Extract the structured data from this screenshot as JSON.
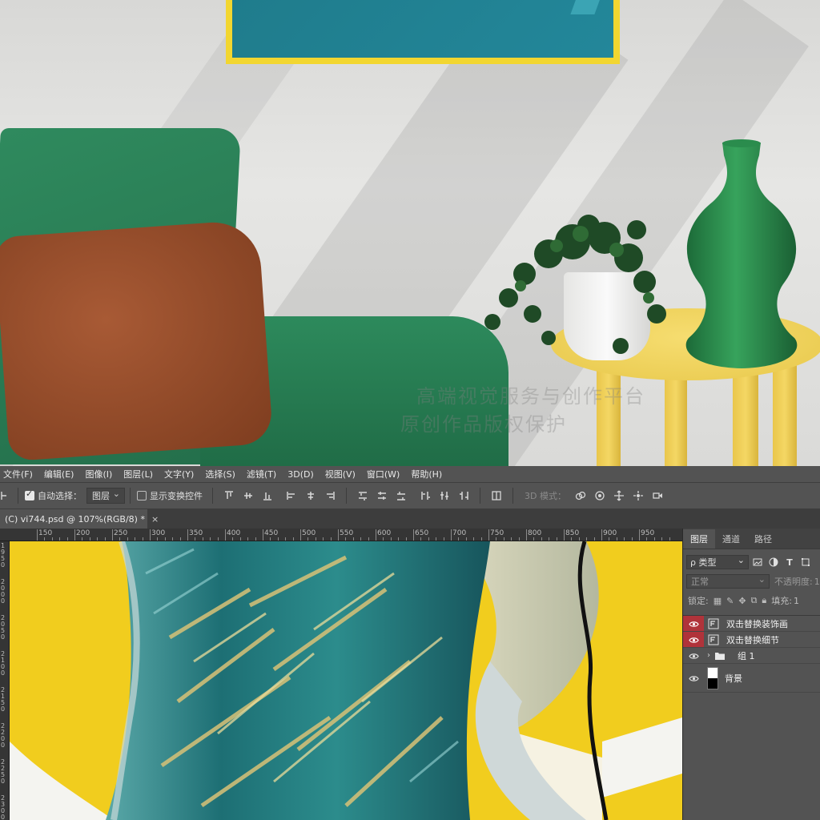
{
  "menu": [
    "文件(F)",
    "编辑(E)",
    "图像(I)",
    "图层(L)",
    "文字(Y)",
    "选择(S)",
    "滤镜(T)",
    "3D(D)",
    "视图(V)",
    "窗口(W)",
    "帮助(H)"
  ],
  "options": {
    "auto_select_label": "自动选择：",
    "auto_select_value": "图层",
    "show_transform_label": "显示变换控件",
    "mode_3d_label": "3D 模式："
  },
  "document": {
    "tab_title": "(C) vi744.psd @ 107%(RGB/8) *",
    "close": "×"
  },
  "ruler": {
    "top_labels": [
      "150",
      "200",
      "250",
      "300",
      "350",
      "400",
      "450",
      "500",
      "550",
      "600",
      "650",
      "700",
      "750",
      "800",
      "850",
      "900",
      "950"
    ],
    "left_labels": [
      "1950",
      "2000",
      "2050",
      "2100",
      "2150",
      "2200",
      "2250",
      "2300"
    ]
  },
  "watermark": {
    "line1": "高端视觉服务与创作平台",
    "line2": "原创作品版权保护"
  },
  "layers_panel": {
    "tabs": [
      "图层",
      "通道",
      "路径"
    ],
    "active_tab": "图层",
    "filter_value": "ρ 类型",
    "blend_mode": "正常",
    "opacity_label": "不透明度:",
    "opacity_value": "1",
    "lock_label": "锁定:",
    "fill_label": "填充:",
    "fill_value": "1",
    "layers": [
      {
        "name": "双击替换装饰画",
        "type": "smart-object",
        "highlighted": true
      },
      {
        "name": "双击替换细节",
        "type": "smart-object",
        "highlighted": true
      },
      {
        "name": "组 1",
        "type": "group",
        "highlighted": false
      },
      {
        "name": "背景",
        "type": "background",
        "highlighted": false
      }
    ]
  },
  "colors": {
    "photoshop_panel": "#535353",
    "eye_highlight": "#b0333a",
    "canvas_yellow": "#f1cd1e",
    "teal": "#1f7c8c",
    "sofa_green": "#2d8a5c"
  }
}
